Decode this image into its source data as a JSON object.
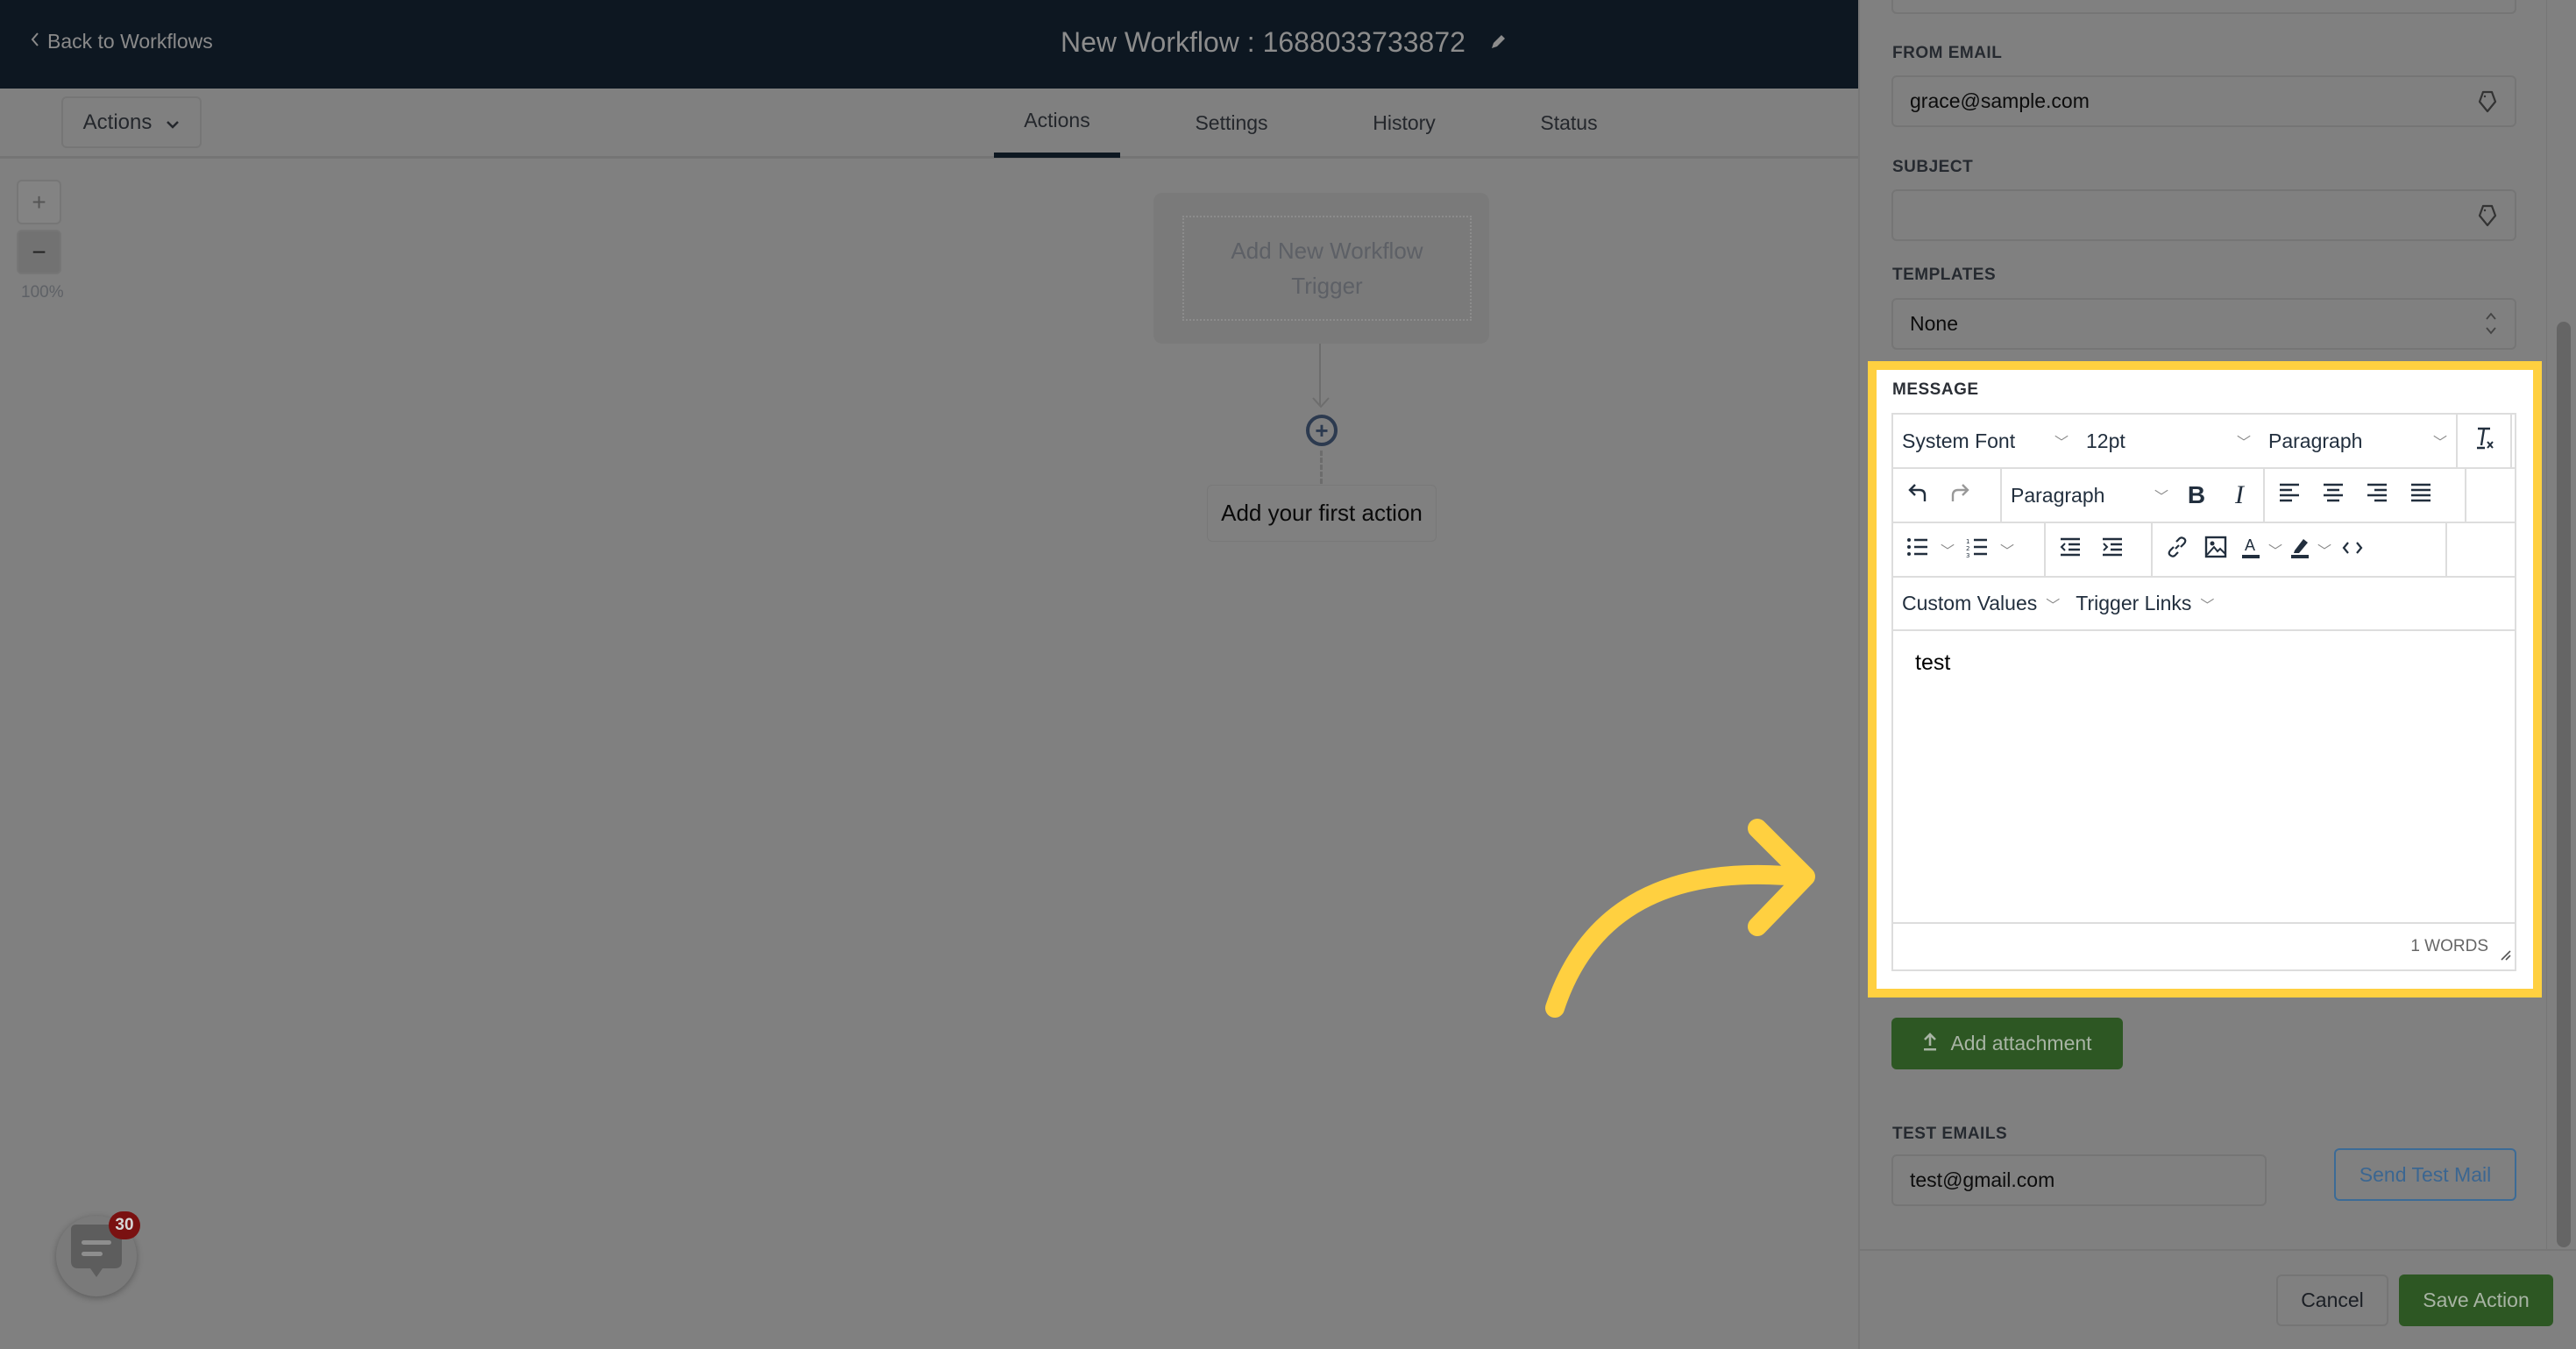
{
  "header": {
    "back_label": "Back to Workflows",
    "title": "New Workflow : 1688033733872"
  },
  "toolbar": {
    "actions_dropdown": "Actions",
    "tabs": [
      {
        "label": "Actions",
        "active": true
      },
      {
        "label": "Settings",
        "active": false
      },
      {
        "label": "History",
        "active": false
      },
      {
        "label": "Status",
        "active": false
      }
    ]
  },
  "canvas": {
    "zoom_in": "+",
    "zoom_out": "−",
    "zoom_level": "100%",
    "trigger_label": "Add New Workflow Trigger",
    "add_action_label": "Add your first action"
  },
  "chat_widget": {
    "badge_count": "30"
  },
  "panel": {
    "from_email": {
      "label": "FROM EMAIL",
      "value": "grace@sample.com"
    },
    "subject": {
      "label": "SUBJECT",
      "value": ""
    },
    "templates": {
      "label": "TEMPLATES",
      "value": "None"
    },
    "message": {
      "label": "MESSAGE",
      "font_family": "System Font",
      "font_size": "12pt",
      "block_format_1": "Paragraph",
      "block_format_2": "Paragraph",
      "custom_values": "Custom Values",
      "trigger_links": "Trigger Links",
      "body": "test",
      "word_count": "1 WORDS"
    },
    "add_attachment": "Add attachment",
    "test_emails": {
      "label": "TEST EMAILS",
      "value": "test@gmail.com"
    },
    "send_test_mail": "Send Test Mail",
    "cancel": "Cancel",
    "save_action": "Save Action"
  },
  "colors": {
    "highlight": "#ffd040",
    "primary_green": "#2d5723",
    "header_bg": "#0d1721",
    "link_blue": "#3b6691"
  }
}
